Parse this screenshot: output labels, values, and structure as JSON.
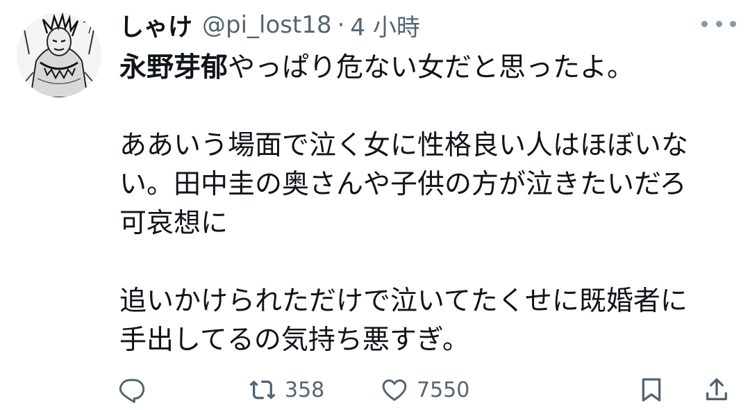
{
  "post": {
    "author": {
      "display_name": "しゃけ",
      "handle": "@pi_lost18",
      "separator": "·",
      "time": "4 小時"
    },
    "text": {
      "mention": "永野芽郁",
      "line1_rest": "やっぱり危ない女だと思ったよ。",
      "para2_line1": "ああいう場面で泣く女に性格良い人はほぼいな",
      "para2_line2": "い。田中圭の奥さんや子供の方が泣きたいだろ",
      "para2_line3": "可哀想に",
      "para3_line1": "追いかけられただけで泣いてたくせに既婚者に",
      "para3_line2": "手出してるの気持ち悪すぎ。"
    },
    "actions": {
      "reply_icon": "reply-icon",
      "retweet_icon": "retweet-icon",
      "retweet_count": "358",
      "like_icon": "heart-icon",
      "like_count": "7550",
      "bookmark_icon": "bookmark-icon",
      "share_icon": "share-icon"
    },
    "colors": {
      "text": "#0f1419",
      "secondary": "#536471"
    }
  }
}
